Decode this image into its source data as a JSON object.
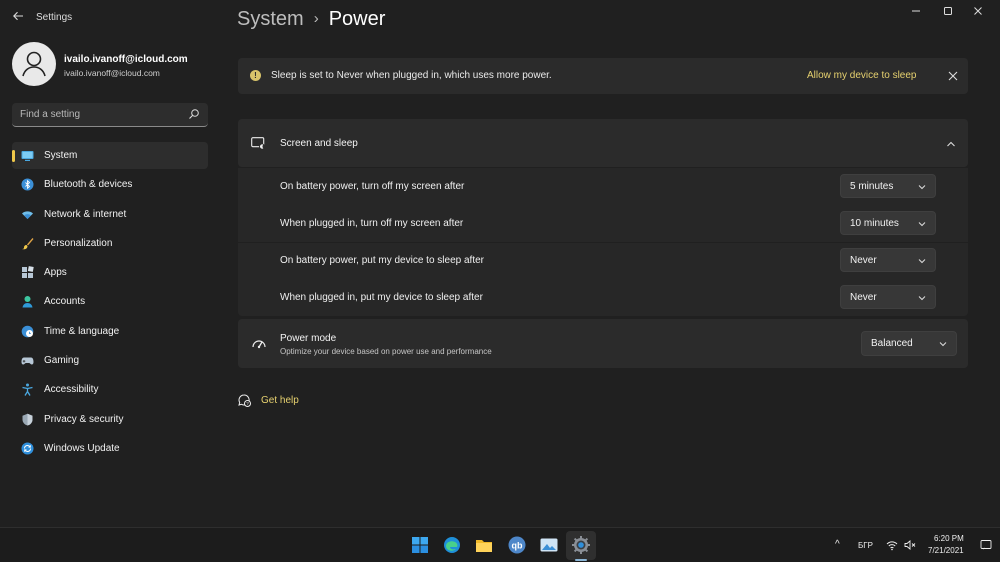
{
  "window": {
    "app_title": "Settings",
    "back_icon": "arrow-left-icon",
    "controls": [
      "minimize-icon",
      "maximize-icon",
      "close-icon"
    ]
  },
  "profile": {
    "name": "ivailo.ivanoff@icloud.com",
    "email": "ivailo.ivanoff@icloud.com",
    "avatar_icon": "person-icon"
  },
  "search": {
    "placeholder": "Find a setting",
    "icon": "search-icon"
  },
  "sidebar": {
    "accent": "#f0c84a",
    "items": [
      {
        "label": "System",
        "icon": "monitor-icon",
        "selected": true
      },
      {
        "label": "Bluetooth & devices",
        "icon": "bluetooth-icon",
        "selected": false
      },
      {
        "label": "Network & internet",
        "icon": "wifi-icon",
        "selected": false
      },
      {
        "label": "Personalization",
        "icon": "brush-icon",
        "selected": false
      },
      {
        "label": "Apps",
        "icon": "apps-icon",
        "selected": false
      },
      {
        "label": "Accounts",
        "icon": "person-icon",
        "selected": false
      },
      {
        "label": "Time & language",
        "icon": "globe-clock-icon",
        "selected": false
      },
      {
        "label": "Gaming",
        "icon": "gamepad-icon",
        "selected": false
      },
      {
        "label": "Accessibility",
        "icon": "accessibility-icon",
        "selected": false
      },
      {
        "label": "Privacy & security",
        "icon": "shield-icon",
        "selected": false
      },
      {
        "label": "Windows Update",
        "icon": "update-icon",
        "selected": false
      }
    ]
  },
  "breadcrumb": {
    "parent": "System",
    "separator": "›",
    "current": "Power"
  },
  "banner": {
    "icon": "info-icon",
    "text": "Sleep is set to Never when plugged in, which uses more power.",
    "action": "Allow my device to sleep",
    "close_icon": "close-icon"
  },
  "screen_sleep": {
    "title": "Screen and sleep",
    "icon": "screen-sleep-icon",
    "chevron": "chevron-up-icon",
    "rows": [
      {
        "label": "On battery power, turn off my screen after",
        "value": "5 minutes"
      },
      {
        "label": "When plugged in, turn off my screen after",
        "value": "10 minutes"
      },
      {
        "label": "On battery power, put my device to sleep after",
        "value": "Never"
      },
      {
        "label": "When plugged in, put my device to sleep after",
        "value": "Never"
      }
    ]
  },
  "power_mode": {
    "title": "Power mode",
    "description": "Optimize your device based on power use and performance",
    "value": "Balanced",
    "icon": "power-mode-icon"
  },
  "help": {
    "label": "Get help",
    "icon": "help-icon"
  },
  "taskbar": {
    "apps": [
      "start-icon",
      "edge-icon",
      "file-explorer-icon",
      "qbittorrent-icon",
      "photos-icon",
      "settings-icon"
    ],
    "active_app": "settings-icon",
    "tray": {
      "chevron": "^",
      "language": "БГР",
      "time": "6:20 PM",
      "date": "7/21/2021"
    }
  },
  "colors": {
    "background": "#202020",
    "card": "#2b2b2b",
    "accent": "#e6d16f"
  }
}
